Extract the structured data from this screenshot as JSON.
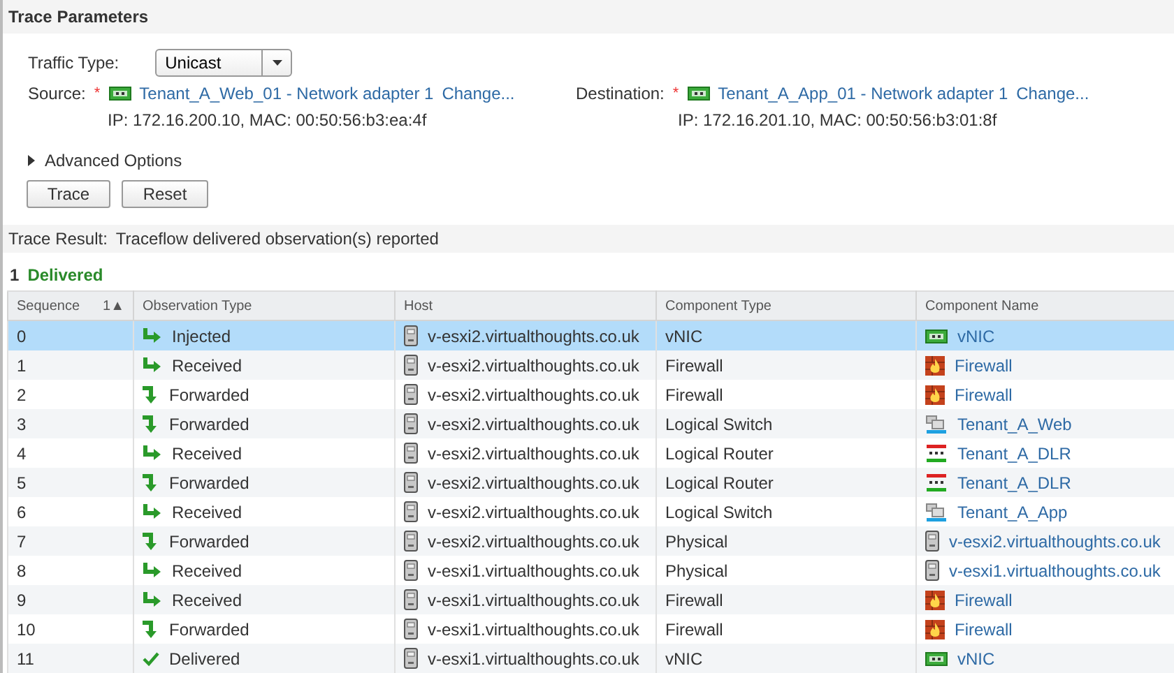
{
  "parameters": {
    "title": "Trace Parameters",
    "traffic_type": {
      "label": "Traffic Type:",
      "value": "Unicast"
    },
    "source": {
      "label": "Source:",
      "required_mark": "*",
      "adapter": "Tenant_A_Web_01 - Network adapter 1",
      "change_link": "Change...",
      "details": "IP: 172.16.200.10, MAC: 00:50:56:b3:ea:4f"
    },
    "destination": {
      "label": "Destination:",
      "required_mark": "*",
      "adapter": "Tenant_A_App_01 - Network adapter 1",
      "change_link": "Change...",
      "details": "IP: 172.16.201.10, MAC: 00:50:56:b3:01:8f"
    },
    "advanced_options": {
      "label": "Advanced Options",
      "expanded": false
    },
    "buttons": [
      "Trace",
      "Reset"
    ]
  },
  "result": {
    "label": "Trace Result:",
    "message": "Traceflow delivered observation(s) reported",
    "delivered_count": "1",
    "delivered_label": "Delivered"
  },
  "table": {
    "columns": [
      "Sequence",
      "Observation Type",
      "Host",
      "Component Type",
      "Component Name"
    ],
    "sort_indicator": "1▲",
    "rows": [
      {
        "sequence": "0",
        "observation": {
          "text": "Injected",
          "kind": "receive"
        },
        "host": "v-esxi2.virtualthoughts.co.uk",
        "component_type": "vNIC",
        "component": {
          "kind": "vnic",
          "name": "vNIC"
        },
        "selected": true
      },
      {
        "sequence": "1",
        "observation": {
          "text": "Received",
          "kind": "receive"
        },
        "host": "v-esxi2.virtualthoughts.co.uk",
        "component_type": "Firewall",
        "component": {
          "kind": "firewall",
          "name": "Firewall"
        },
        "selected": false
      },
      {
        "sequence": "2",
        "observation": {
          "text": "Forwarded",
          "kind": "forward"
        },
        "host": "v-esxi2.virtualthoughts.co.uk",
        "component_type": "Firewall",
        "component": {
          "kind": "firewall",
          "name": "Firewall"
        },
        "selected": false
      },
      {
        "sequence": "3",
        "observation": {
          "text": "Forwarded",
          "kind": "forward"
        },
        "host": "v-esxi2.virtualthoughts.co.uk",
        "component_type": "Logical Switch",
        "component": {
          "kind": "switch",
          "name": "Tenant_A_Web"
        },
        "selected": false
      },
      {
        "sequence": "4",
        "observation": {
          "text": "Received",
          "kind": "receive"
        },
        "host": "v-esxi2.virtualthoughts.co.uk",
        "component_type": "Logical Router",
        "component": {
          "kind": "router",
          "name": "Tenant_A_DLR"
        },
        "selected": false
      },
      {
        "sequence": "5",
        "observation": {
          "text": "Forwarded",
          "kind": "forward"
        },
        "host": "v-esxi2.virtualthoughts.co.uk",
        "component_type": "Logical Router",
        "component": {
          "kind": "router",
          "name": "Tenant_A_DLR"
        },
        "selected": false
      },
      {
        "sequence": "6",
        "observation": {
          "text": "Received",
          "kind": "receive"
        },
        "host": "v-esxi2.virtualthoughts.co.uk",
        "component_type": "Logical Switch",
        "component": {
          "kind": "switch",
          "name": "Tenant_A_App"
        },
        "selected": false
      },
      {
        "sequence": "7",
        "observation": {
          "text": "Forwarded",
          "kind": "forward"
        },
        "host": "v-esxi2.virtualthoughts.co.uk",
        "component_type": "Physical",
        "component": {
          "kind": "host",
          "name": "v-esxi2.virtualthoughts.co.uk"
        },
        "selected": false
      },
      {
        "sequence": "8",
        "observation": {
          "text": "Received",
          "kind": "receive"
        },
        "host": "v-esxi1.virtualthoughts.co.uk",
        "component_type": "Physical",
        "component": {
          "kind": "host",
          "name": "v-esxi1.virtualthoughts.co.uk"
        },
        "selected": false
      },
      {
        "sequence": "9",
        "observation": {
          "text": "Received",
          "kind": "receive"
        },
        "host": "v-esxi1.virtualthoughts.co.uk",
        "component_type": "Firewall",
        "component": {
          "kind": "firewall",
          "name": "Firewall"
        },
        "selected": false
      },
      {
        "sequence": "10",
        "observation": {
          "text": "Forwarded",
          "kind": "forward"
        },
        "host": "v-esxi1.virtualthoughts.co.uk",
        "component_type": "Firewall",
        "component": {
          "kind": "firewall",
          "name": "Firewall"
        },
        "selected": false
      },
      {
        "sequence": "11",
        "observation": {
          "text": "Delivered",
          "kind": "deliver"
        },
        "host": "v-esxi1.virtualthoughts.co.uk",
        "component_type": "vNIC",
        "component": {
          "kind": "vnic",
          "name": "vNIC"
        },
        "selected": false
      }
    ]
  }
}
